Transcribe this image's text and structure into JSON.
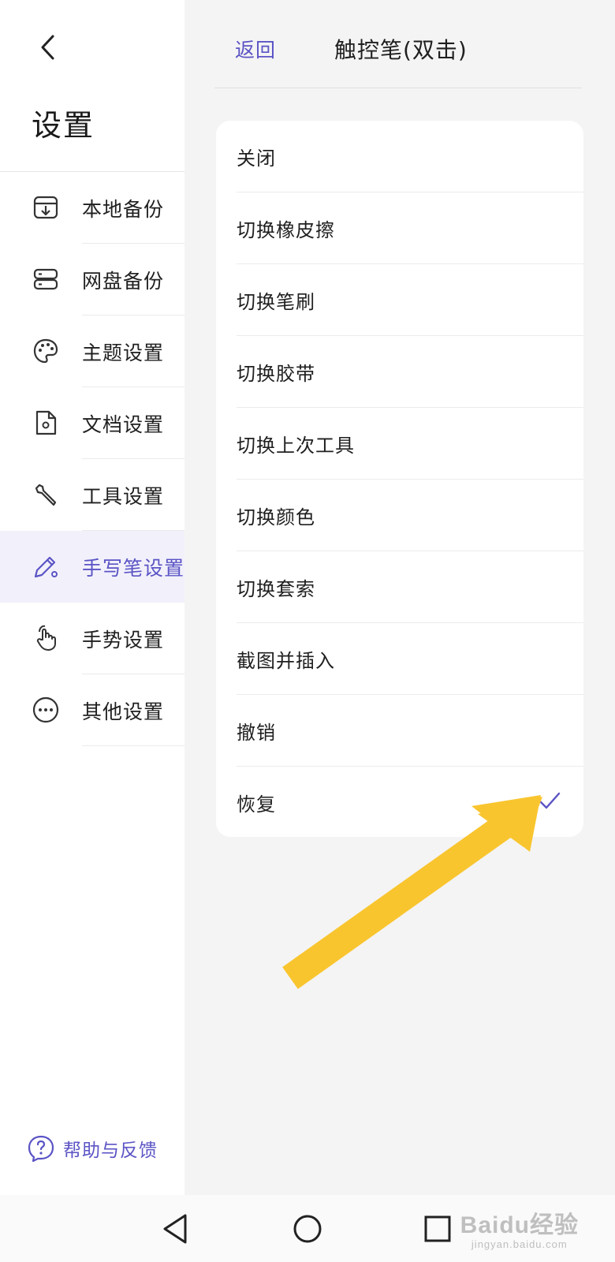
{
  "sidebar": {
    "title": "设置",
    "items": [
      {
        "label": "本地备份",
        "icon": "local-backup-icon"
      },
      {
        "label": "网盘备份",
        "icon": "cloud-backup-icon"
      },
      {
        "label": "主题设置",
        "icon": "palette-icon"
      },
      {
        "label": "文档设置",
        "icon": "document-settings-icon"
      },
      {
        "label": "工具设置",
        "icon": "wrench-icon"
      },
      {
        "label": "手写笔设置",
        "icon": "pen-settings-icon",
        "active": true
      },
      {
        "label": "手势设置",
        "icon": "gesture-hand-icon"
      },
      {
        "label": "其他设置",
        "icon": "more-dots-icon"
      }
    ],
    "help_label": "帮助与反馈"
  },
  "panel": {
    "back_label": "返回",
    "title": "触控笔(双击)",
    "options": [
      {
        "label": "关闭"
      },
      {
        "label": "切换橡皮擦"
      },
      {
        "label": "切换笔刷"
      },
      {
        "label": "切换胶带"
      },
      {
        "label": "切换上次工具"
      },
      {
        "label": "切换颜色"
      },
      {
        "label": "切换套索"
      },
      {
        "label": "截图并插入"
      },
      {
        "label": "撤销"
      },
      {
        "label": "恢复",
        "selected": true
      }
    ]
  },
  "colors": {
    "accent": "#5b54c5",
    "active_bg": "#f2f1fb",
    "panel_bg": "#f4f4f4",
    "arrow": "#f9c52f"
  },
  "watermark": {
    "main": "Baidu经验",
    "sub": "jingyan.baidu.com"
  }
}
